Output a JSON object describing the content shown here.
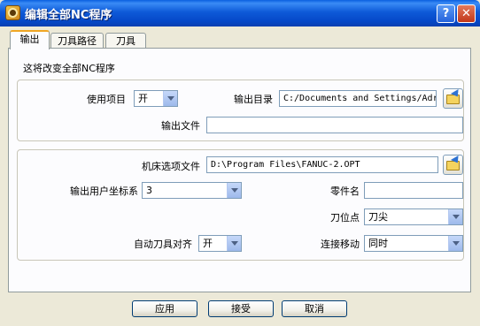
{
  "window": {
    "title": "编辑全部NC程序"
  },
  "tabs": [
    {
      "label": "输出"
    },
    {
      "label": "刀具路径"
    },
    {
      "label": "刀具"
    }
  ],
  "panel": {
    "description": "这将改变全部NC程序"
  },
  "group1": {
    "use_item_label": "使用项目",
    "use_item_value": "开",
    "output_dir_label": "输出目录",
    "output_dir_value": "C:/Documents and Settings/Adr",
    "output_file_label": "输出文件",
    "output_file_value": ""
  },
  "group2": {
    "machine_option_label": "机床选项文件",
    "machine_option_value": "D:\\Program Files\\FANUC-2.OPT",
    "user_coord_label": "输出用户坐标系",
    "user_coord_value": "3",
    "part_name_label": "零件名",
    "part_name_value": "",
    "tool_point_label": "刀位点",
    "tool_point_value": "刀尖",
    "auto_align_label": "自动刀具对齐",
    "auto_align_value": "开",
    "link_move_label": "连接移动",
    "link_move_value": "同时"
  },
  "buttons": {
    "apply": "应用",
    "accept": "接受",
    "cancel": "取消"
  },
  "titlebar_buttons": {
    "help": "?",
    "close": "✕"
  },
  "icons": [
    "app-icon",
    "help-icon",
    "close-icon",
    "folder-browse-icon",
    "dropdown-arrow-icon"
  ]
}
